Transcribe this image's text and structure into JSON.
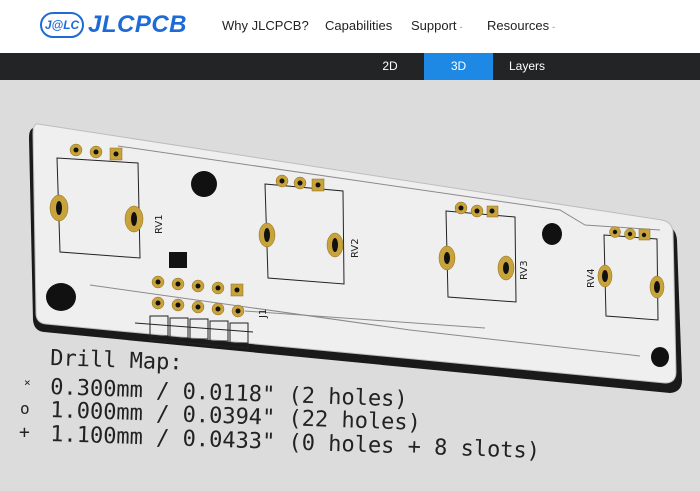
{
  "header": {
    "logo_badge": "J@LC",
    "logo_text": "JLCPCB",
    "nav": [
      {
        "label": "Why JLCPCB?",
        "has_caret": false
      },
      {
        "label": "Capabilities",
        "has_caret": false
      },
      {
        "label": "Support",
        "has_caret": true
      },
      {
        "label": "Resources",
        "has_caret": true
      }
    ]
  },
  "tabs": [
    {
      "label": "2D",
      "active": false
    },
    {
      "label": "3D",
      "active": true
    },
    {
      "label": "Layers",
      "active": false
    }
  ],
  "board": {
    "silk_labels": [
      "RV1",
      "RV2",
      "RV3",
      "RV4",
      "J1"
    ],
    "drill_map": {
      "title": "Drill Map:",
      "rows": [
        {
          "symbol": "×",
          "text": "0.300mm / 0.0118\" (2 holes)"
        },
        {
          "symbol": "o",
          "text": "1.000mm / 0.0394\" (22 holes)"
        },
        {
          "symbol": "+",
          "text": "1.100mm / 0.0433\" (0 holes + 8 slots)"
        }
      ]
    }
  },
  "colors": {
    "brand_blue": "#1e6bd6",
    "tab_bar": "#222426",
    "tab_active": "#1e88e5",
    "board_surface": "#efefef",
    "board_edge": "#1a1a1a",
    "pad_gold": "#c8a23a",
    "viewport_bg": "#dcdcdc"
  }
}
